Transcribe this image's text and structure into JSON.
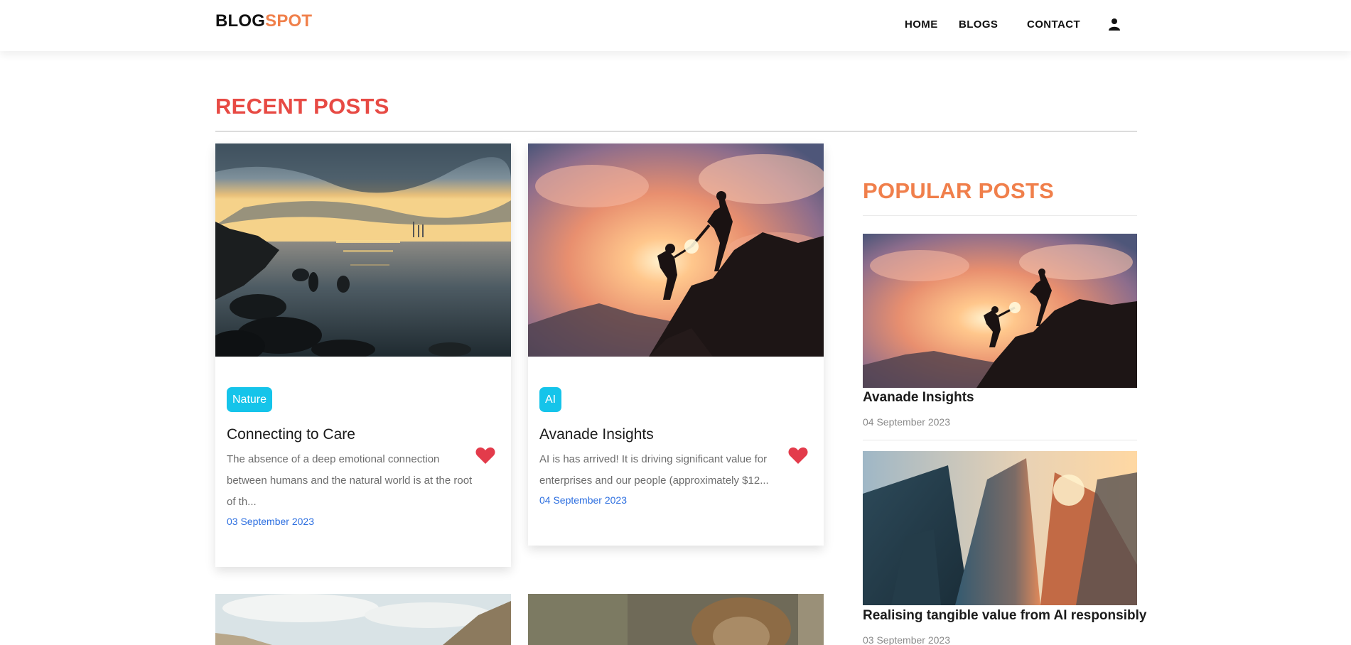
{
  "header": {
    "brand_part1": "BLOG",
    "brand_part2": "SPOT",
    "nav": {
      "home": "HOME",
      "blogs": "BLOGS",
      "contact": "CONTACT"
    },
    "user_icon": "user-icon"
  },
  "recent": {
    "title": "RECENT POSTS",
    "posts": [
      {
        "tag": "Nature",
        "title": "Connecting to Care",
        "excerpt": "The absence of a deep emotional connection between humans and the natural world is at the root of th...",
        "date": "03 September 2023",
        "image": "sea-sunset"
      },
      {
        "tag": "AI",
        "title": "Avanade Insights",
        "excerpt": "AI is has arrived! It is driving significant value for enterprises and our people (approximately $12...",
        "date": "04 September 2023",
        "image": "climbers-sunset"
      }
    ]
  },
  "popular": {
    "title": "POPULAR POSTS",
    "posts": [
      {
        "title": "Avanade Insights",
        "date": "04 September 2023",
        "image": "climbers-sunset"
      },
      {
        "title": "Realising tangible value from AI responsibly",
        "date": "03 September 2023",
        "image": "glass-skyscrapers"
      }
    ]
  },
  "colors": {
    "brand_accent": "#f0804b",
    "recent_title": "#e74a44",
    "popular_title": "#f07f4b",
    "tag_bg": "#15c4ea",
    "date_link": "#2d6fe0",
    "heart": "#e33b4b"
  }
}
